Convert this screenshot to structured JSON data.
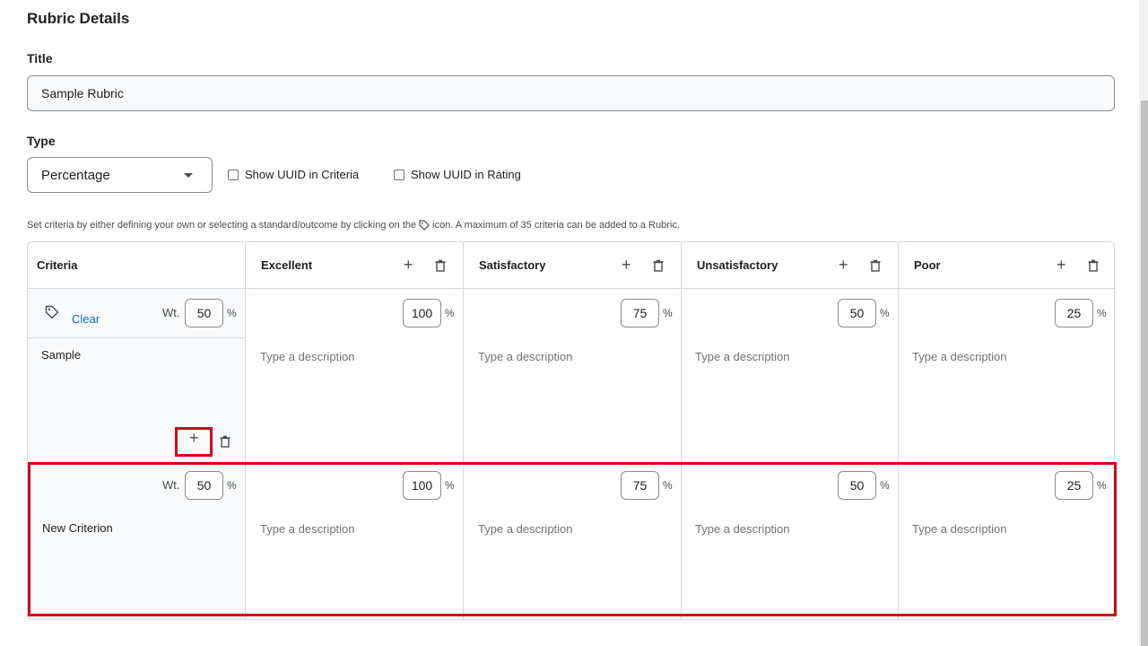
{
  "page": {
    "section_title": "Rubric Details",
    "title_label": "Title",
    "title_value": "Sample Rubric",
    "type_label": "Type",
    "type_selected": "Percentage",
    "show_uuid_criteria": "Show UUID in Criteria",
    "show_uuid_rating": "Show UUID in Rating",
    "hint_before": "Set criteria by either defining your own or selecting a standard/outcome by clicking on the",
    "hint_after": "icon. A maximum of 35 criteria can be added to a Rubric."
  },
  "table": {
    "criteria_header": "Criteria",
    "levels": [
      {
        "name": "Excellent",
        "value": "100"
      },
      {
        "name": "Satisfactory",
        "value": "75"
      },
      {
        "name": "Unsatisfactory",
        "value": "50"
      },
      {
        "name": "Poor",
        "value": "25"
      }
    ],
    "wt_label": "Wt.",
    "pct": "%",
    "desc_placeholder": "Type a description",
    "rows": [
      {
        "clear_label": "Clear",
        "weight": "50",
        "name": "Sample"
      },
      {
        "weight": "50",
        "name": "New Criterion"
      }
    ]
  },
  "colors": {
    "accent": "#006fbf",
    "highlight": "#d0021b"
  }
}
